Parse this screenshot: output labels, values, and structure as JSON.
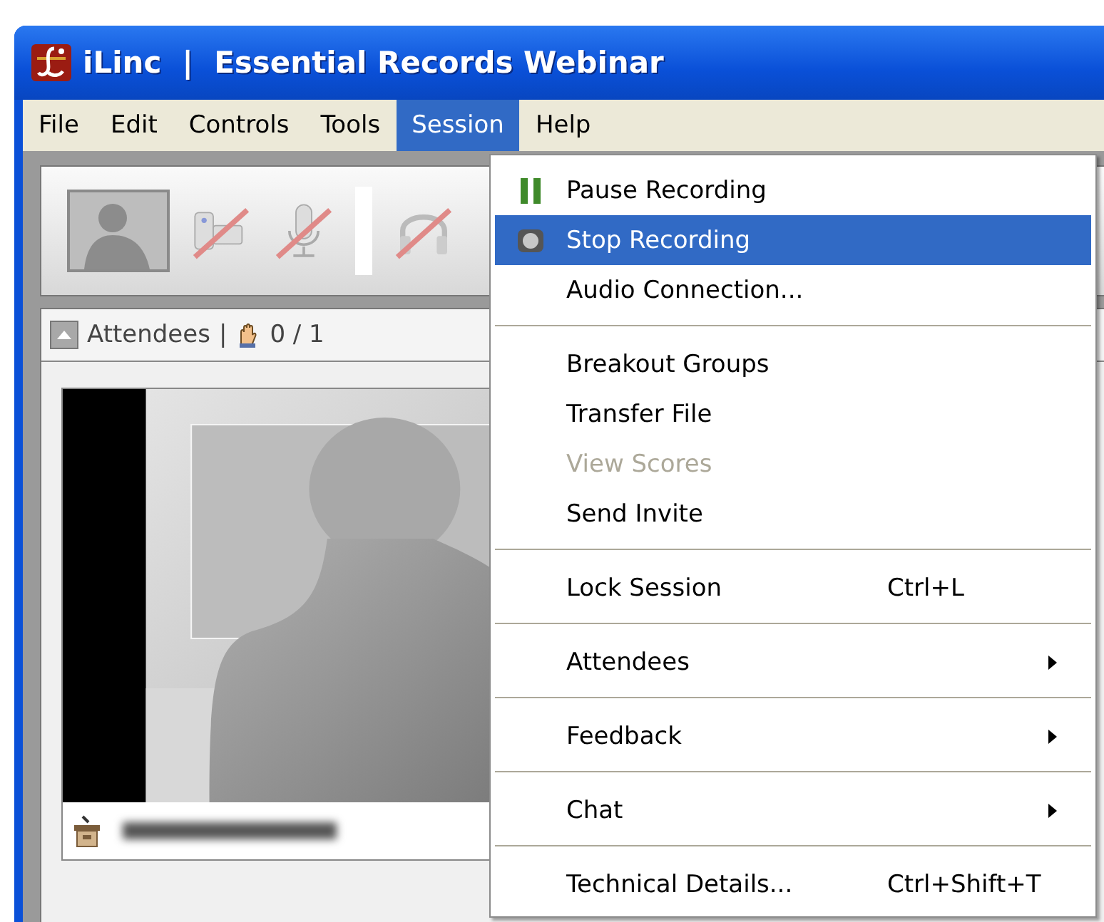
{
  "window": {
    "title": "iLinc  |  Essential Records Webinar"
  },
  "menu_bar": [
    {
      "label": "File",
      "selected": false
    },
    {
      "label": "Edit",
      "selected": false
    },
    {
      "label": "Controls",
      "selected": false
    },
    {
      "label": "Tools",
      "selected": false
    },
    {
      "label": "Session",
      "selected": true
    },
    {
      "label": "Help",
      "selected": false
    }
  ],
  "toolbar": [
    {
      "kind": "video",
      "disabled": false
    },
    {
      "kind": "webcam",
      "disabled": true
    },
    {
      "kind": "microphone",
      "disabled": true
    },
    {
      "kind": "headset",
      "disabled": true
    }
  ],
  "attendees_panel": {
    "title": "Attendees",
    "divider": "|",
    "hand_count": "0 / 1"
  },
  "session_menu": [
    {
      "items": [
        {
          "label": "Pause Recording",
          "kind": "pause",
          "selected": false,
          "disabled": false,
          "submenu": false
        },
        {
          "label": "Stop Recording",
          "kind": "stop",
          "selected": true,
          "disabled": false,
          "submenu": false
        },
        {
          "label": "Audio Connection...",
          "selected": false,
          "disabled": false,
          "submenu": false
        }
      ]
    },
    {
      "items": [
        {
          "label": "Breakout Groups",
          "selected": false,
          "disabled": false,
          "submenu": false
        },
        {
          "label": "Transfer File",
          "selected": false,
          "disabled": false,
          "submenu": false
        },
        {
          "label": "View Scores",
          "selected": false,
          "disabled": true,
          "submenu": false
        },
        {
          "label": "Send Invite",
          "selected": false,
          "disabled": false,
          "submenu": false
        }
      ]
    },
    {
      "items": [
        {
          "label": "Lock Session",
          "shortcut": "Ctrl+L",
          "selected": false,
          "disabled": false,
          "submenu": false
        }
      ]
    },
    {
      "items": [
        {
          "label": "Attendees",
          "selected": false,
          "disabled": false,
          "submenu": true
        }
      ]
    },
    {
      "items": [
        {
          "label": "Feedback",
          "selected": false,
          "disabled": false,
          "submenu": true
        }
      ]
    },
    {
      "items": [
        {
          "label": "Chat",
          "selected": false,
          "disabled": false,
          "submenu": true
        }
      ]
    },
    {
      "items": [
        {
          "label": "Technical Details...",
          "shortcut": "Ctrl+Shift+T",
          "selected": false,
          "disabled": false,
          "submenu": false
        }
      ]
    }
  ]
}
